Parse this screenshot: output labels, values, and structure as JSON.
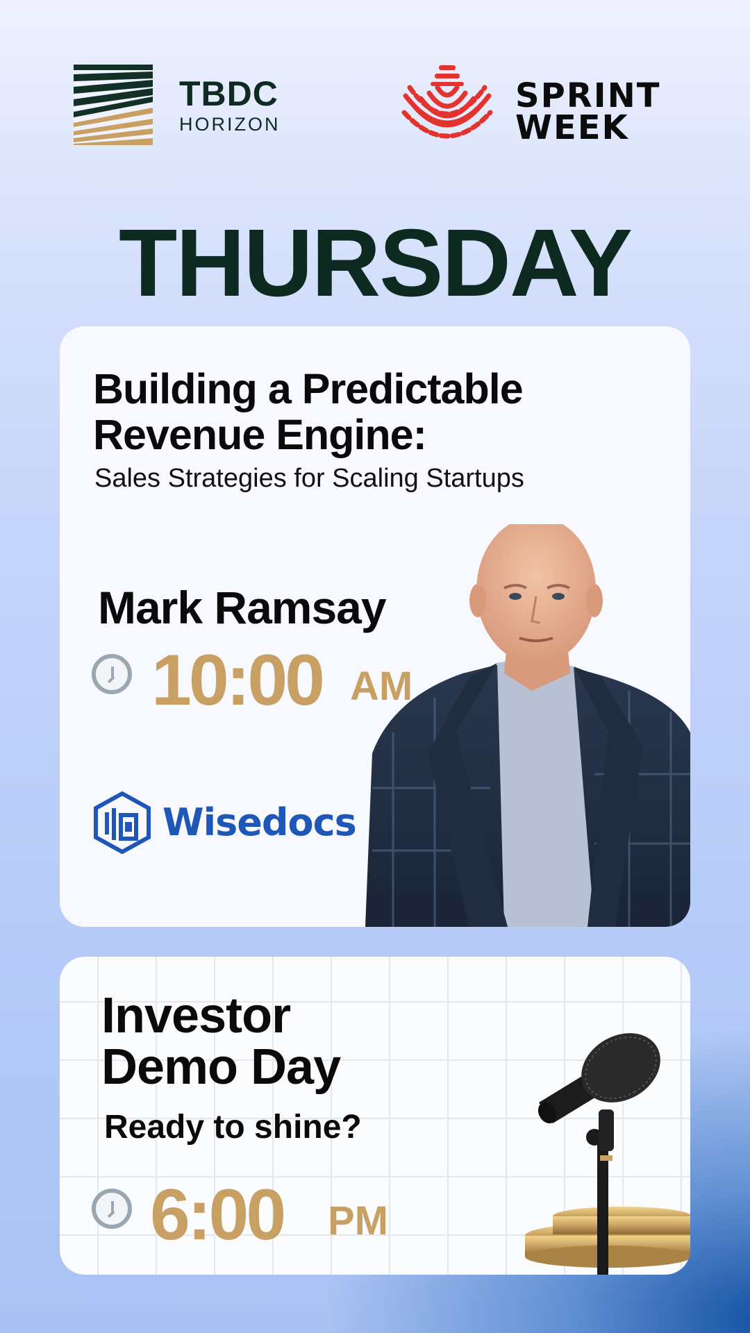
{
  "header": {
    "tbdc": {
      "line1": "TBDC",
      "line2": "HORIZON"
    },
    "sprint": {
      "line1": "SPRINT",
      "line2": "WEEK"
    }
  },
  "day": "THURSDAY",
  "session1": {
    "title_line1": "Building a Predictable",
    "title_line2": "Revenue Engine:",
    "subtitle": "Sales Strategies for Scaling Startups",
    "speaker": "Mark Ramsay",
    "time": "10:00",
    "period": "AM",
    "company": "Wisedocs"
  },
  "session2": {
    "title_line1": "Investor",
    "title_line2": "Demo Day",
    "subtitle": "Ready to shine?",
    "time": "6:00",
    "period": "PM"
  },
  "colors": {
    "dark_green": "#0d2a21",
    "gold": "#c9a063",
    "sprint_red": "#e2332f",
    "wisedocs_blue": "#1e57b8"
  }
}
